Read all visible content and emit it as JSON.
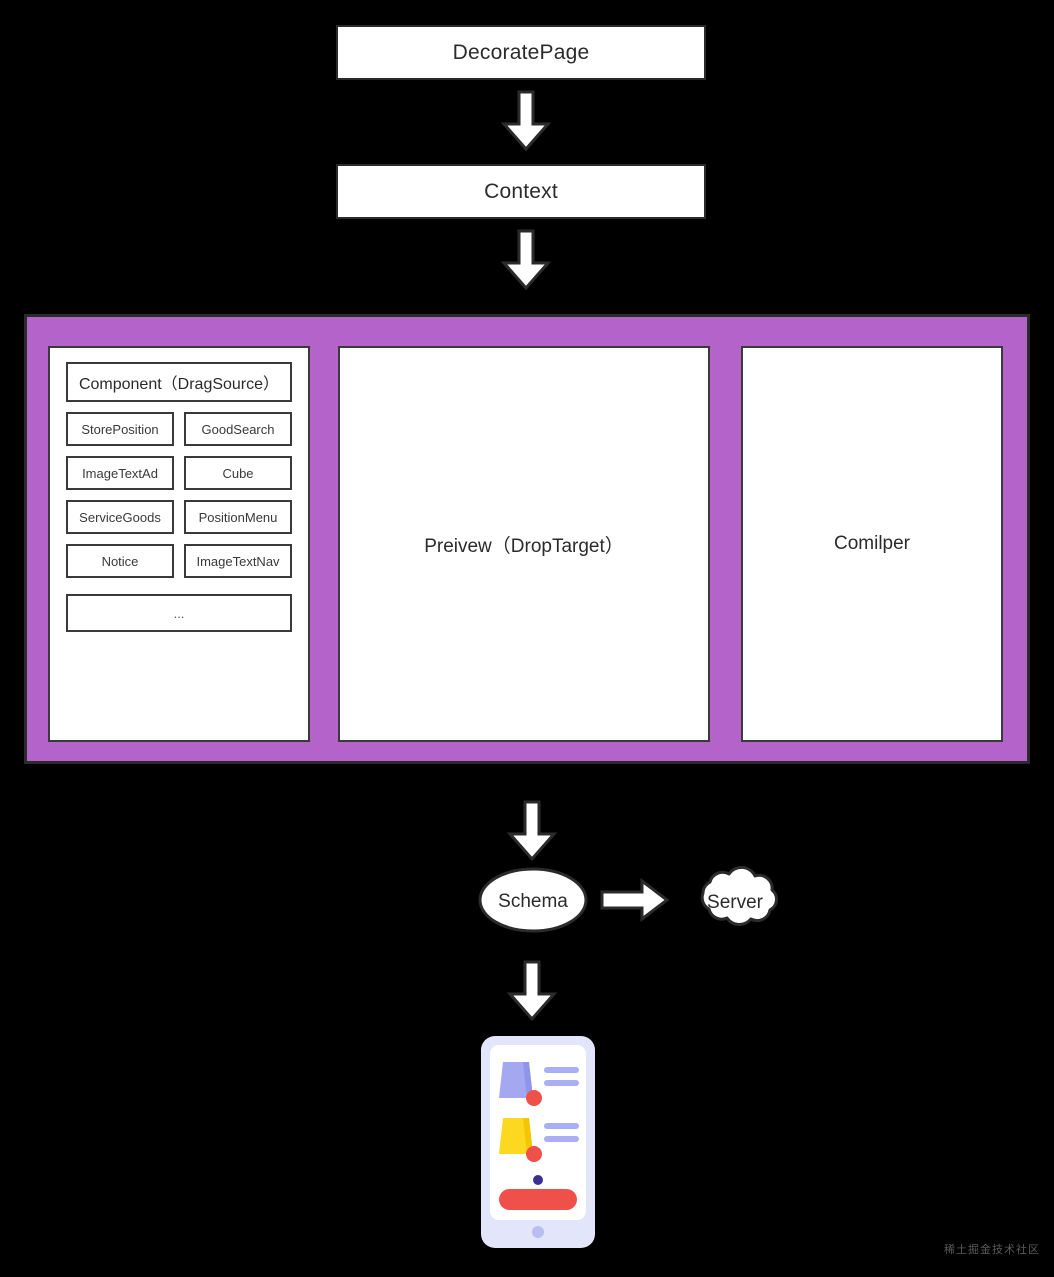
{
  "diagram": {
    "background_color": "#000000",
    "accent_color": "#b363c9",
    "node_fill": "#ffffff",
    "node_stroke": "#2b2b2b"
  },
  "nodes": {
    "decorate_page": "DecoratePage",
    "context": "Context",
    "preview": "Preivew（DropTarget）",
    "compiler": "Comilper",
    "schema": "Schema",
    "server": "Server"
  },
  "component_panel": {
    "header": "Component（DragSource）",
    "rows": [
      [
        "StorePosition",
        "GoodSearch"
      ],
      [
        "ImageTextAd",
        "Cube"
      ],
      [
        "ServiceGoods",
        "PositionMenu"
      ],
      [
        "Notice",
        "ImageTextNav"
      ]
    ],
    "more": "..."
  },
  "icons": {
    "arrow_down": "arrow-down-icon",
    "arrow_right": "arrow-right-icon",
    "phone": "phone-mockup-icon",
    "cloud": "cloud-icon",
    "ellipse": "ellipse-icon"
  },
  "phone_mockup": {
    "frame_color": "#e3e5fb",
    "screen_color": "#ffffff",
    "bag_purple": "#a3a8f0",
    "bag_purple_shade": "#8f95e8",
    "bag_yellow": "#fcd820",
    "bag_yellow_shade": "#f2c600",
    "dot_red": "#f0504a",
    "text_bar": "#a9aef5",
    "dot_navy": "#3b2f8f",
    "button_red": "#f0504a"
  },
  "watermark": "稀土掘金技术社区"
}
